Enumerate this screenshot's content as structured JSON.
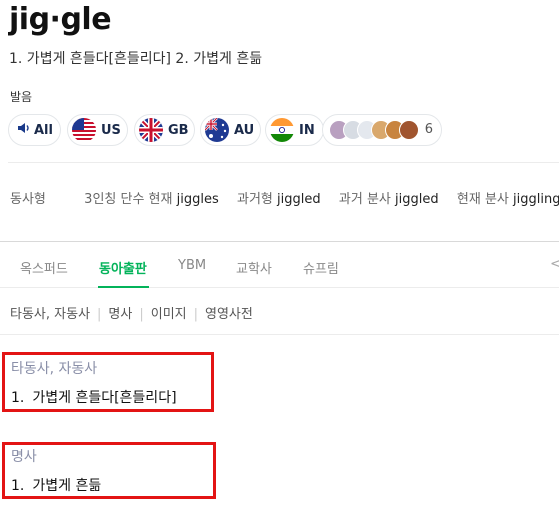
{
  "entry": {
    "word": "jig·gle",
    "summary": "1. 가볍게 흔들다[흔들리다] 2. 가볍게 흔듦"
  },
  "pronunciation": {
    "label": "발음",
    "buttons": [
      {
        "code": "All",
        "icon": "speaker-icon"
      },
      {
        "code": "US",
        "icon": "us-flag-icon"
      },
      {
        "code": "GB",
        "icon": "uk-flag-icon"
      },
      {
        "code": "AU",
        "icon": "australia-flag-icon"
      },
      {
        "code": "IN",
        "icon": "india-flag-icon"
      }
    ],
    "user_count": "6"
  },
  "verb_forms": {
    "label": "동사형",
    "items": [
      {
        "label": "3인칭 단수 현재",
        "value": "jiggles"
      },
      {
        "label": "과거형",
        "value": "jiggled"
      },
      {
        "label": "과거 분사",
        "value": "jiggled"
      },
      {
        "label": "현재 분사",
        "value": "jiggling"
      }
    ]
  },
  "tabs": {
    "items": [
      "옥스퍼드",
      "동아출판",
      "YBM",
      "교학사",
      "슈프림"
    ],
    "active": "동아출판",
    "arrow": "<"
  },
  "subnav": [
    "타동사, 자동사",
    "명사",
    "이미지",
    "영영사전"
  ],
  "senses": [
    {
      "pos": "타동사, 자동사",
      "num": "1.",
      "def": "가볍게 흔들다[흔들리다]"
    },
    {
      "pos": "명사",
      "num": "1.",
      "def": "가볍게 흔듦"
    }
  ],
  "colors": {
    "accent": "#03b35a",
    "highlight_box": "#e31414"
  }
}
